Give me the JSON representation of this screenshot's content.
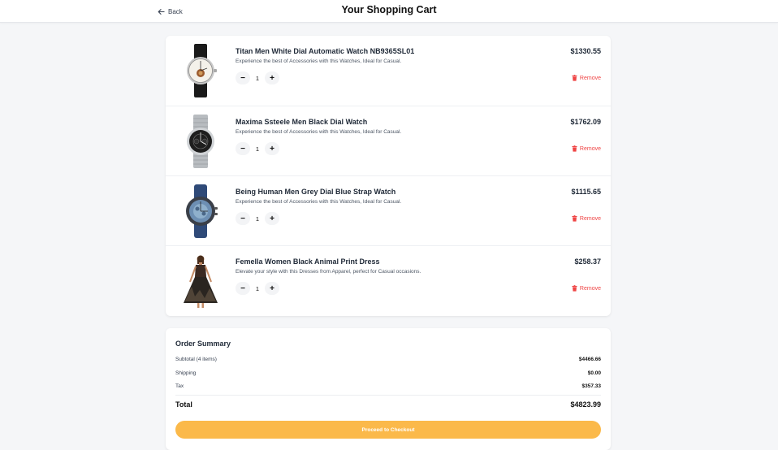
{
  "header": {
    "back_label": "Back",
    "title": "Your Shopping Cart"
  },
  "cart": {
    "items": [
      {
        "name": "Titan Men White Dial Automatic Watch NB9365SL01",
        "description": "Experience the best of Accessories with this Watches, Ideal for Casual.",
        "quantity": "1",
        "price": "$1330.55",
        "remove_label": "Remove",
        "image": "watch-white-dial-black-strap"
      },
      {
        "name": "Maxima Ssteele Men Black Dial Watch",
        "description": "Experience the best of Accessories with this Watches, Ideal for Casual.",
        "quantity": "1",
        "price": "$1762.09",
        "remove_label": "Remove",
        "image": "watch-black-dial-steel-strap"
      },
      {
        "name": "Being Human Men Grey Dial Blue Strap Watch",
        "description": "Experience the best of Accessories with this Watches, Ideal for Casual.",
        "quantity": "1",
        "price": "$1115.65",
        "remove_label": "Remove",
        "image": "watch-grey-dial-blue-strap"
      },
      {
        "name": "Femella Women Black Animal Print Dress",
        "description": "Elevate your style with this Dresses from Apparel, perfect for Casual occasions.",
        "quantity": "1",
        "price": "$258.37",
        "remove_label": "Remove",
        "image": "dress-black-animal-print"
      }
    ]
  },
  "summary": {
    "title": "Order Summary",
    "subtotal_label": "Subtotal (4 items)",
    "subtotal_value": "$4466.66",
    "shipping_label": "Shipping",
    "shipping_value": "$0.00",
    "tax_label": "Tax",
    "tax_value": "$357.33",
    "total_label": "Total",
    "total_value": "$4823.99",
    "checkout_label": "Proceed to Checkout"
  },
  "colors": {
    "accent": "#fbb94a",
    "remove": "#ef4444",
    "background": "#f5f6f8"
  }
}
